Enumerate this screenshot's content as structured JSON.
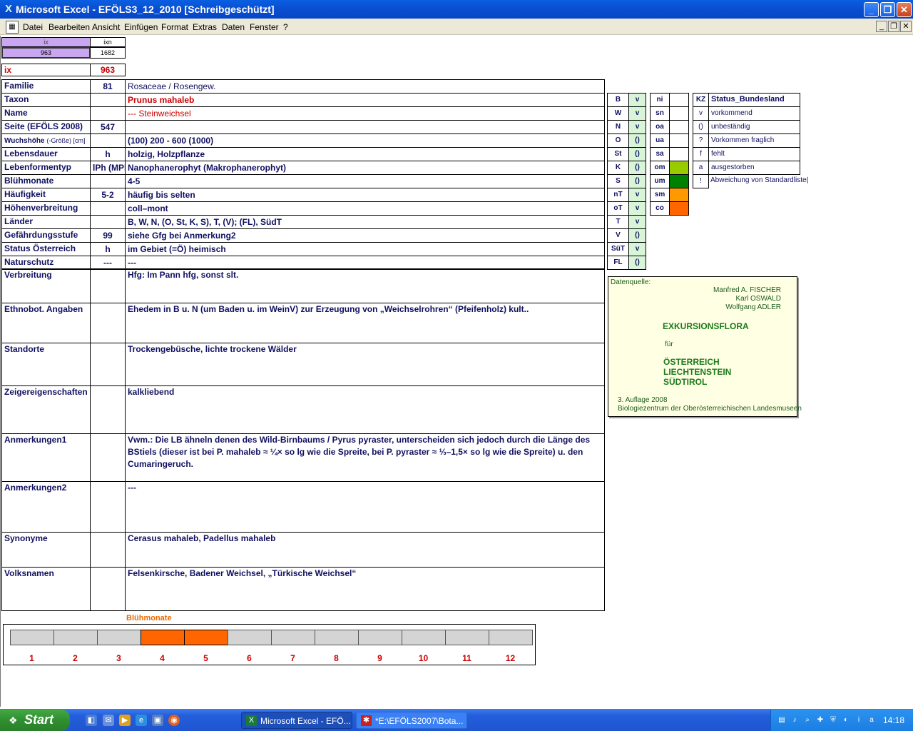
{
  "window": {
    "title": "Microsoft Excel - EFÖLS3_12_2010  [Schreibgeschützt]",
    "controls": {
      "minimize": "_",
      "restore": "❐",
      "close": "✕"
    }
  },
  "menu": [
    "Datei",
    "Bearbeiten",
    "Ansicht",
    "Einfügen",
    "Format",
    "Extras",
    "Daten",
    "Fenster",
    "?"
  ],
  "mdi_controls": {
    "minimize": "_",
    "restore": "❐",
    "close": "✕"
  },
  "top_cells": {
    "ix_label": "ix",
    "ixn_label": "ixn",
    "ix_value": "963",
    "ixn_value": "1682"
  },
  "ix_row": {
    "label": "ix",
    "value": "963"
  },
  "rows": [
    {
      "label": "Familie",
      "num": "81",
      "text": "Rosaceae  /  Rosengew."
    },
    {
      "label": "Taxon",
      "num": "",
      "text": "Prunus mahaleb"
    },
    {
      "label": "Name",
      "num": "",
      "text": "--- Steinweichsel"
    },
    {
      "label": "Seite (EFÖLS 2008)",
      "num": "547",
      "text": ""
    },
    {
      "label": "Wuchshöhe",
      "label_extra": "(-Größe) [cm]",
      "num": "",
      "text": "(100) 200 - 600 (1000)"
    },
    {
      "label": "Lebensdauer",
      "num": "h",
      "text": "holzig, Holzpflanze"
    },
    {
      "label": "Lebenformentyp",
      "num": "lPh (MPh",
      "text": "Nanophanerophyt (Makrophanerophyt)"
    },
    {
      "label": "Blühmonate",
      "num": "",
      "text": "4-5"
    },
    {
      "label": "Häufigkeit",
      "num": "5-2",
      "text": "häufig bis selten"
    },
    {
      "label": "Höhenverbreitung",
      "num": "",
      "text": "coll–mont"
    },
    {
      "label": "Länder",
      "num": "",
      "text": "B, W, N, (O, St, K, S), T, (V); (FL), SüdT"
    },
    {
      "label": "Gefährdungsstufe",
      "num": "99",
      "text": "siehe Gfg bei Anmerkung2"
    },
    {
      "label": "Status Österreich",
      "num": "h",
      "text": "im Gebiet (=Ö) heimisch"
    },
    {
      "label": "Naturschutz",
      "num": "---",
      "text": "---"
    }
  ],
  "tall_rows": [
    {
      "label": "Verbreitung",
      "text": "Hfg:  Im Pann hfg, sonst slt."
    },
    {
      "label": "Ethnobot. Angaben",
      "text": "Ehedem in B u. N (um Baden u. im WeinV) zur Erzeugung von „Weichselrohren“ (Pfeifenholz) kult.."
    },
    {
      "label": "Standorte",
      "text": "Trockengebüsche, lichte trockene Wälder"
    },
    {
      "label": "Zeigereigenschaften",
      "text": "kalkliebend"
    },
    {
      "label": "Anmerkungen1",
      "text": "Vwm.: Die LB ähneln denen des Wild-Birnbaums / Pyrus pyraster, unterscheiden sich jedoch durch die Länge des BStiels (dieser ist bei P. mahaleb ≈ ¼× so lg wie die Spreite, bei P. pyraster ≈ ⅓–1,5× so lg wie die Spreite) u. den Cumaringeruch."
    },
    {
      "label": "Anmerkungen2",
      "text": "---"
    },
    {
      "label": "Synonyme",
      "text": "Cerasus mahaleb, Padellus mahaleb"
    },
    {
      "label": "Volksnamen",
      "text": "Felsenkirsche, Badener Weichsel,   „Türkische Weichsel“"
    }
  ],
  "laender": [
    {
      "code": "B",
      "v": "v"
    },
    {
      "code": "W",
      "v": "v"
    },
    {
      "code": "N",
      "v": "v"
    },
    {
      "code": "O",
      "v": "()"
    },
    {
      "code": "St",
      "v": "()"
    },
    {
      "code": "K",
      "v": "()"
    },
    {
      "code": "S",
      "v": "()"
    },
    {
      "code": "nT",
      "v": "v"
    },
    {
      "code": "oT",
      "v": "v"
    },
    {
      "code": "T",
      "v": "v"
    },
    {
      "code": "V",
      "v": "()"
    },
    {
      "code": "SüT",
      "v": "v"
    },
    {
      "code": "FL",
      "v": "()"
    }
  ],
  "hoehen": [
    {
      "code": "ni",
      "color": ""
    },
    {
      "code": "sn",
      "color": ""
    },
    {
      "code": "oa",
      "color": ""
    },
    {
      "code": "ua",
      "color": ""
    },
    {
      "code": "sa",
      "color": ""
    },
    {
      "code": "om",
      "color": "#99cc00"
    },
    {
      "code": "um",
      "color": "#008000"
    },
    {
      "code": "sm",
      "color": "#ff9900"
    },
    {
      "code": "co",
      "color": "#ff6600"
    }
  ],
  "status_legend": {
    "header_kz": "KZ",
    "header_title": "Status_Bundesland",
    "items": [
      {
        "kz": "v",
        "text": "vorkommend"
      },
      {
        "kz": "()",
        "text": "unbeständig"
      },
      {
        "kz": "?",
        "text": "Vorkommen fraglich"
      },
      {
        "kz": "f",
        "text": "fehlt"
      },
      {
        "kz": "a",
        "text": "ausgestorben"
      },
      {
        "kz": "!",
        "text": "Abweichung von Standardliste(?)"
      }
    ]
  },
  "datenquelle": {
    "label": "Datenquelle:",
    "authors": [
      "Manfred A. FISCHER",
      "Karl OSWALD",
      "Wolfgang ADLER"
    ],
    "book": "EXKURSIONSFLORA",
    "fuer": "für",
    "countries": [
      "ÖSTERREICH",
      "LIECHTENSTEIN",
      "SÜDTIROL"
    ],
    "edition": "3. Auflage 2008",
    "publisher": "Biologiezentrum der Oberösterreichischen Landesmuseen"
  },
  "bluehmonate_chart": {
    "title": "Blühmonate",
    "months": [
      "1",
      "2",
      "3",
      "4",
      "5",
      "6",
      "7",
      "8",
      "9",
      "10",
      "11",
      "12"
    ],
    "active": [
      4,
      5
    ],
    "active_color": "#ff6600",
    "inactive_color": "#d4d4d4"
  },
  "taskbar": {
    "start": "Start",
    "tasks": [
      "Microsoft Excel - EFÖ...",
      "*E:\\EFÖLS2007\\Bota..."
    ],
    "clock": "14:18"
  }
}
